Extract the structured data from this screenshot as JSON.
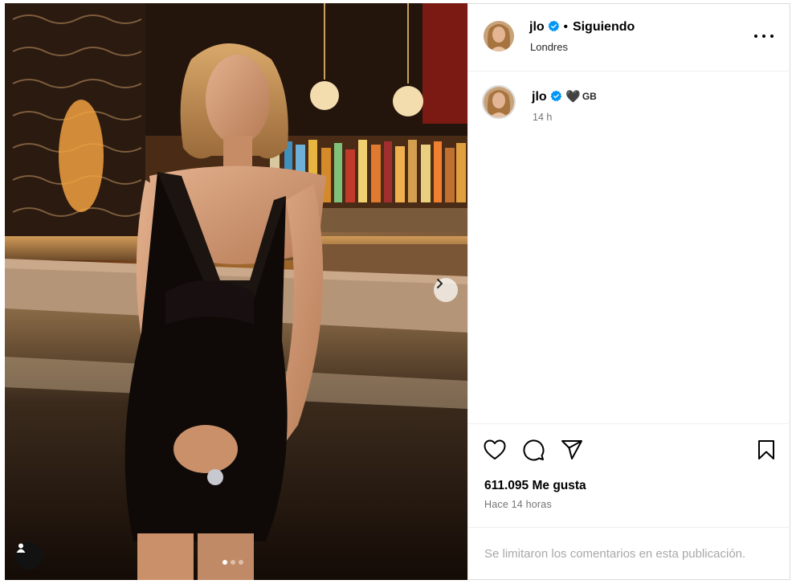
{
  "post": {
    "username": "jlo",
    "follow_status": "Siguiendo",
    "location": "Londres",
    "caption": {
      "username": "jlo",
      "emoji": "🖤",
      "text": "GB",
      "time": "14 h"
    },
    "likes": "611.095 Me gusta",
    "posted": "Hace 14 horas",
    "comments_disabled": "Se limitaron los comentarios en esta publicación.",
    "carousel": {
      "slides": 3,
      "active": 1
    }
  },
  "colors": {
    "verified": "#0095f6",
    "text": "#000000",
    "secondary": "#737373",
    "muted": "#a8a8a8",
    "divider": "#efefef"
  },
  "icons": [
    "verified-badge-icon",
    "more-options-icon",
    "heart-icon",
    "comment-icon",
    "share-icon",
    "save-icon",
    "user-tag-icon",
    "chevron-right-icon"
  ]
}
